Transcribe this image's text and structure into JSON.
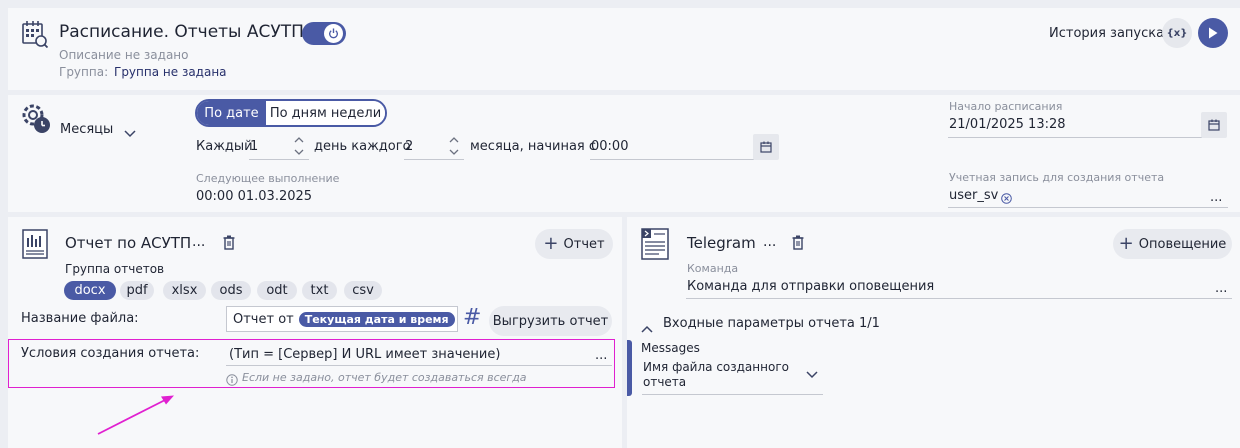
{
  "header": {
    "title": "Расписание. Отчеты АСУТП",
    "description": "Описание не задано",
    "group_label": "Группа:",
    "group_value": "Группа не задана",
    "history_link": "История запуска",
    "vars_label": "{x}"
  },
  "schedule": {
    "period": "Месяцы",
    "tab_by_date": "По дате",
    "tab_by_weekdays": "По дням недели",
    "every_label": "Каждый",
    "every_value": "1",
    "day_of_each_label": "день каждого",
    "months_value": "2",
    "months_from_label": "месяца, начиная с",
    "time_value": "00:00",
    "next_run_label": "Следующее выполнение",
    "next_run_value": "00:00 01.03.2025",
    "start_label": "Начало расписания",
    "start_value": "21/01/2025 13:28",
    "account_label": "Учетная запись для создания отчета",
    "account_value": "user_sv",
    "more": "..."
  },
  "report": {
    "title": "Отчет по АСУТП",
    "more": "...",
    "add_button": "Отчет",
    "group_label": "Группа отчетов",
    "formats": [
      "docx",
      "pdf",
      "xlsx",
      "ods",
      "odt",
      "txt",
      "csv"
    ],
    "selected_format": "docx",
    "filename_label": "Название файла:",
    "filename_prefix": "Отчет от",
    "filename_token": "Текущая дата и время",
    "hash": "#",
    "export_button": "Выгрузить отчет",
    "conditions_label": "Условия создания отчета:",
    "conditions_value": "(Тип = [Сервер] И URL имеет значение)",
    "conditions_more": "...",
    "conditions_hint": "Если не задано, отчет будет создаваться всегда"
  },
  "notification": {
    "title": "Telegram",
    "more": "...",
    "add_button": "Оповещение",
    "command_label": "Команда",
    "command_value": "Команда для отправки оповещения",
    "command_more": "...",
    "inputs_header": "Входные параметры отчета 1/1",
    "messages_label": "Messages",
    "messages_value_line1": "Имя файла созданного",
    "messages_value_line2": "отчета"
  },
  "colors": {
    "accent": "#4a5aa5",
    "highlight_box": "#e020d0",
    "arrow": "#e020d0"
  }
}
